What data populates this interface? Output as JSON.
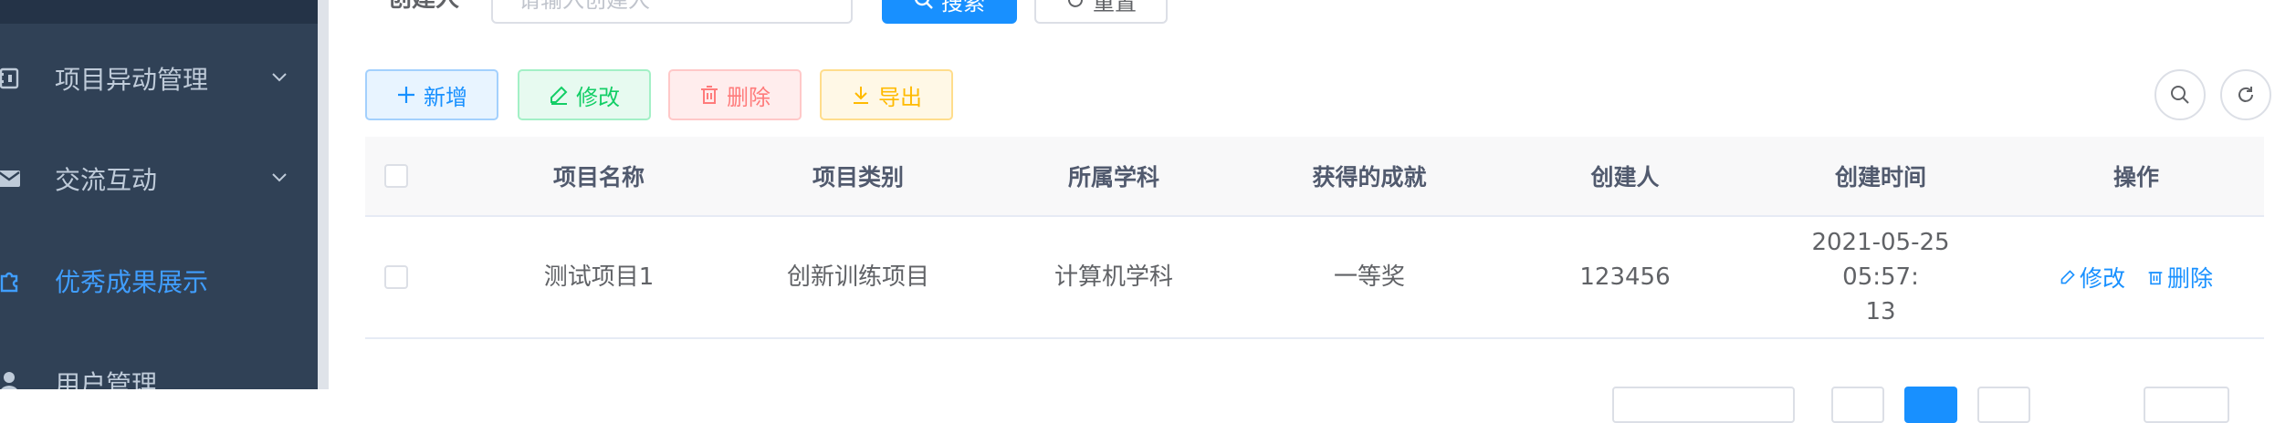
{
  "sidebar": {
    "items": [
      {
        "label": "项目异动管理",
        "icon": "notebook-icon",
        "expandable": true
      },
      {
        "label": "交流互动",
        "icon": "message-icon",
        "expandable": true
      },
      {
        "label": "优秀成果展示",
        "icon": "puzzle-icon",
        "active": true
      },
      {
        "label": "用户管理",
        "icon": "user-icon"
      }
    ]
  },
  "search": {
    "label": "创建人",
    "placeholder": "请输入创建人",
    "search_label": "搜索",
    "reset_label": "重置"
  },
  "toolbar": {
    "add_label": "新增",
    "edit_label": "修改",
    "delete_label": "删除",
    "export_label": "导出"
  },
  "table": {
    "columns": [
      "项目名称",
      "项目类别",
      "所属学科",
      "获得的成就",
      "创建人",
      "创建时间",
      "操作"
    ],
    "rows": [
      {
        "name": "测试项目1",
        "category": "创新训练项目",
        "subject": "计算机学科",
        "achievement": "一等奖",
        "creator": "123456",
        "created_at_line1": "2021-05-25 05:57:",
        "created_at_line2": "13",
        "edit_label": "修改",
        "delete_label": "删除"
      }
    ]
  },
  "colors": {
    "sidebar_bg": "#304156",
    "sidebar_text": "#bfcbd9",
    "accent": "#1890ff",
    "active_menu": "#409eff"
  }
}
